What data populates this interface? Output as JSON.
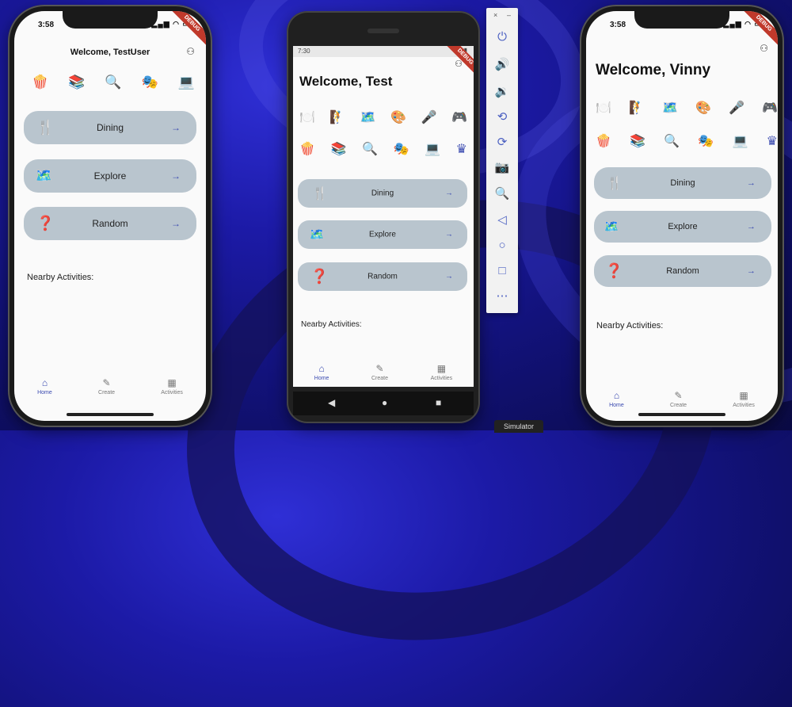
{
  "phones": {
    "left": {
      "time": "3:58",
      "debug_label": "DEBUG",
      "title": "Welcome, TestUser",
      "emojis": [
        "🍿",
        "📚",
        "🔍",
        "🎭",
        "💻"
      ],
      "buttons": [
        {
          "icon": "🍴",
          "label": "Dining",
          "arrow": "→"
        },
        {
          "icon": "🗺️",
          "label": "Explore",
          "arrow": "→"
        },
        {
          "icon": "❓",
          "label": "Random",
          "arrow": "→"
        }
      ],
      "nearby": "Nearby Activities:",
      "nav": [
        {
          "icon": "⌂",
          "label": "Home"
        },
        {
          "icon": "✎",
          "label": "Create"
        },
        {
          "icon": "▦",
          "label": "Activities"
        }
      ]
    },
    "middle": {
      "time": "7:30",
      "debug_label": "DEBUG",
      "title": "Welcome, Test",
      "emoji_rows": [
        [
          "🍽️",
          "🧗",
          "🗺️",
          "🎨",
          "🎤",
          "🎮"
        ],
        [
          "🍿",
          "📚",
          "🔍",
          "🎭",
          "💻",
          "♛"
        ]
      ],
      "buttons": [
        {
          "icon": "🍴",
          "label": "Dining",
          "arrow": "→"
        },
        {
          "icon": "🗺️",
          "label": "Explore",
          "arrow": "→"
        },
        {
          "icon": "❓",
          "label": "Random",
          "arrow": "→"
        }
      ],
      "nearby": "Nearby Activities:",
      "nav": [
        {
          "icon": "⌂",
          "label": "Home"
        },
        {
          "icon": "✎",
          "label": "Create"
        },
        {
          "icon": "▦",
          "label": "Activities"
        }
      ],
      "system_nav": [
        "◀",
        "●",
        "■"
      ]
    },
    "right": {
      "time": "3:58",
      "debug_label": "DEBUG",
      "title": "Welcome, Vinny",
      "emoji_rows": [
        [
          "🍽️",
          "🧗",
          "🗺️",
          "🎨",
          "🎤",
          "🎮"
        ],
        [
          "🍿",
          "📚",
          "🔍",
          "🎭",
          "💻",
          "♛"
        ]
      ],
      "buttons": [
        {
          "icon": "🍴",
          "label": "Dining",
          "arrow": "→"
        },
        {
          "icon": "🗺️",
          "label": "Explore",
          "arrow": "→"
        },
        {
          "icon": "❓",
          "label": "Random",
          "arrow": "→"
        }
      ],
      "nearby": "Nearby Activities:",
      "nav": [
        {
          "icon": "⌂",
          "label": "Home"
        },
        {
          "icon": "✎",
          "label": "Create"
        },
        {
          "icon": "▦",
          "label": "Activities"
        }
      ]
    }
  },
  "simulator": {
    "label": "Simulator",
    "window_controls": [
      "×",
      "–"
    ],
    "tools": [
      "⏻",
      "🔊",
      "🔉",
      "⟲",
      "⟳",
      "📷",
      "🔍",
      "◁",
      "○",
      "□",
      "⋯"
    ]
  },
  "colors": {
    "button_bg": "#b9c5ce",
    "accent": "#3a4ab0",
    "debug": "#c0392b"
  }
}
